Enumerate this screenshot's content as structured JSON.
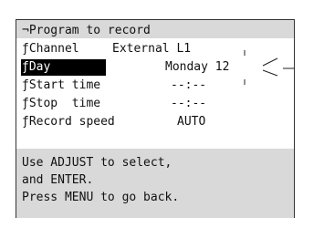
{
  "screen": {
    "title": "¬Program to record",
    "items": [
      {
        "label": "ƒChannel",
        "value": "External L1"
      },
      {
        "label": "ƒDay",
        "value": "Monday 12"
      },
      {
        "label": "ƒStart time",
        "value": "--:--"
      },
      {
        "label": "ƒStop  time",
        "value": "--:--"
      },
      {
        "label": "ƒRecord speed",
        "value": "AUTO"
      }
    ],
    "help": [
      "Use ADJUST to select,",
      "and ENTER.",
      "Press MENU to go back."
    ]
  }
}
